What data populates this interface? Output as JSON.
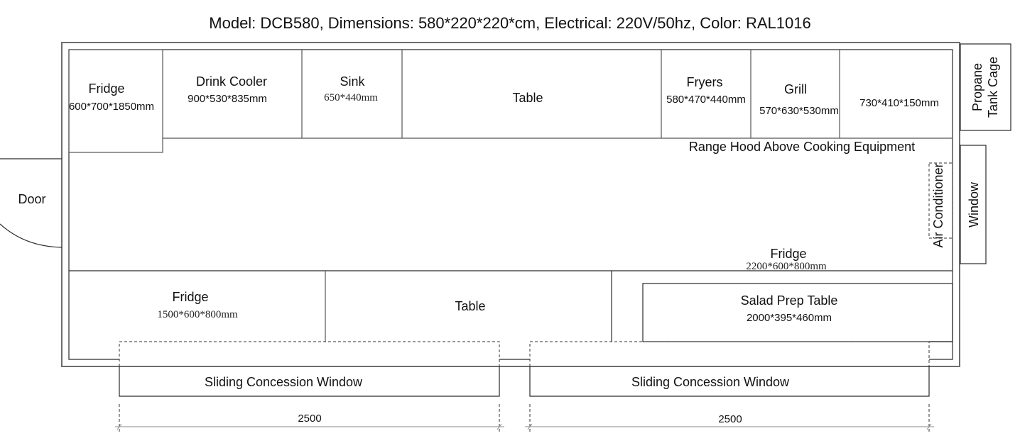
{
  "title": "Model: DCB580, Dimensions: 580*220*220*cm, Electrical: 220V/50hz, Color: RAL1016",
  "top_row": [
    {
      "name": "Fridge",
      "dims": "600*700*1850mm"
    },
    {
      "name": "Drink Cooler",
      "dims": "900*530*835mm"
    },
    {
      "name": "Sink",
      "dims": "650*440mm"
    },
    {
      "name": "Table",
      "dims": ""
    },
    {
      "name": "Fryers",
      "dims": "580*470*440mm"
    },
    {
      "name": "Grill",
      "dims": "570*630*530mm"
    },
    {
      "name": "",
      "dims": "730*410*150mm"
    }
  ],
  "range_hood": "Range Hood Above Cooking Equipment",
  "air_conditioner": "Air Conditioner",
  "middle_fridge": {
    "name": "Fridge",
    "dims": "2200*600*800mm"
  },
  "bottom_row": [
    {
      "name": "Fridge",
      "dims": "1500*600*800mm"
    },
    {
      "name": "Table",
      "dims": ""
    },
    {
      "name": "Salad Prep Table",
      "dims": "2000*395*460mm"
    }
  ],
  "door": "Door",
  "propane": {
    "line1": "Propane",
    "line2": "Tank Cage"
  },
  "side_window": "Window",
  "concession_windows": [
    {
      "label": "Sliding Concession Window",
      "dimension": "2500"
    },
    {
      "label": "Sliding Concession Window",
      "dimension": "2500"
    }
  ]
}
